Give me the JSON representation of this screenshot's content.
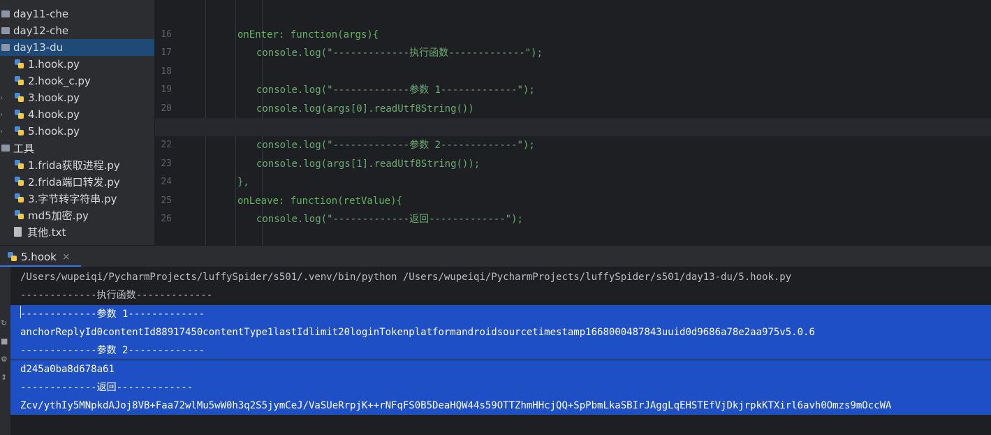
{
  "project_tree": {
    "items": [
      {
        "label": "day11-che",
        "kind": "folder",
        "icon": "folder-icon"
      },
      {
        "label": "day12-che",
        "kind": "folder",
        "icon": "folder-icon"
      },
      {
        "label": "day13-du",
        "kind": "folder",
        "icon": "folder-icon",
        "selected": true
      },
      {
        "label": "1.hook.py",
        "kind": "python",
        "icon": "python-file-icon"
      },
      {
        "label": "2.hook_c.py",
        "kind": "python",
        "icon": "python-file-icon"
      },
      {
        "label": "3.hook.py",
        "kind": "python",
        "icon": "python-file-icon",
        "collapsible": true
      },
      {
        "label": "4.hook.py",
        "kind": "python",
        "icon": "python-file-icon",
        "collapsible": true
      },
      {
        "label": "5.hook.py",
        "kind": "python",
        "icon": "python-file-icon",
        "collapsible": true
      },
      {
        "label": "工具",
        "kind": "folder",
        "icon": "folder-icon"
      },
      {
        "label": "1.frida获取进程.py",
        "kind": "python",
        "icon": "python-file-icon"
      },
      {
        "label": "2.frida端口转发.py",
        "kind": "python",
        "icon": "python-file-icon"
      },
      {
        "label": "3.字节转字符串.py",
        "kind": "python",
        "icon": "python-file-icon"
      },
      {
        "label": "md5加密.py",
        "kind": "python",
        "icon": "python-file-icon"
      },
      {
        "label": "其他.txt",
        "kind": "text",
        "icon": "text-file-icon"
      }
    ]
  },
  "editor": {
    "current_line": "21",
    "lines": [
      {
        "no": "16",
        "indent": 8,
        "fn": "onEnter:",
        "text": " function(args){",
        "kind": "fn"
      },
      {
        "no": "17",
        "indent": 12,
        "text": "console.log(\"-------------执行函数-------------\");",
        "kind": "plain"
      },
      {
        "no": "18",
        "indent": 0,
        "text": "",
        "kind": "plain"
      },
      {
        "no": "19",
        "indent": 12,
        "text": "console.log(\"-------------参数 1-------------\");",
        "kind": "plain"
      },
      {
        "no": "20",
        "indent": 12,
        "text": "console.log(args[0].readUtf8String())",
        "kind": "plain"
      },
      {
        "no": "21",
        "indent": 0,
        "text": "",
        "kind": "plain"
      },
      {
        "no": "22",
        "indent": 12,
        "text": "console.log(\"-------------参数 2-------------\");",
        "kind": "plain"
      },
      {
        "no": "23",
        "indent": 12,
        "text": "console.log(args[1].readUtf8String());",
        "kind": "plain"
      },
      {
        "no": "24",
        "indent": 8,
        "text": "},",
        "kind": "plain"
      },
      {
        "no": "25",
        "indent": 8,
        "fn": "onLeave:",
        "text": " function(retValue){",
        "kind": "fn"
      },
      {
        "no": "26",
        "indent": 12,
        "text": "console.log(\"-------------返回-------------\");",
        "kind": "plain"
      }
    ]
  },
  "run_panel": {
    "tab_label": "5.hook",
    "close_glyph": "×",
    "output": [
      {
        "text": "/Users/wupeiqi/PycharmProjects/luffySpider/s501/.venv/bin/python /Users/wupeiqi/PycharmProjects/luffySpider/s501/day13-du/5.hook.py",
        "selected": false
      },
      {
        "text": "-------------执行函数-------------",
        "selected": false
      },
      {
        "text": "-------------参数 1-------------",
        "selected": true
      },
      {
        "text": "anchorReplyId0contentId88917450contentType1lastIdlimit20loginTokenplatformandroidsourcetimestamp1668000487843uuid0d9686a78e2aa975v5.0.6",
        "selected": true
      },
      {
        "text": "-------------参数 2-------------",
        "selected": true
      },
      {
        "text": "d245a0ba8d678a61",
        "selected": true
      },
      {
        "text": "-------------返回-------------",
        "selected": true
      },
      {
        "text": "Zcv/ythIy5MNpkdAJoj8VB+Faa72wlMu5wW0h3q2S5jymCeJ/VaSUeRrpjK++rNFqFS0B5DeaHQW44s59OTTZhmHHcjQQ+SpPbmLkaSBIrJAggLqEHSTEfVjDkjrpkKTXirl6avh0Omzs9mOccWA",
        "selected": true
      }
    ]
  },
  "colors": {
    "selection": "#1f4fc4",
    "tree_selected": "#1e4a78",
    "accent": "#3574f0"
  }
}
